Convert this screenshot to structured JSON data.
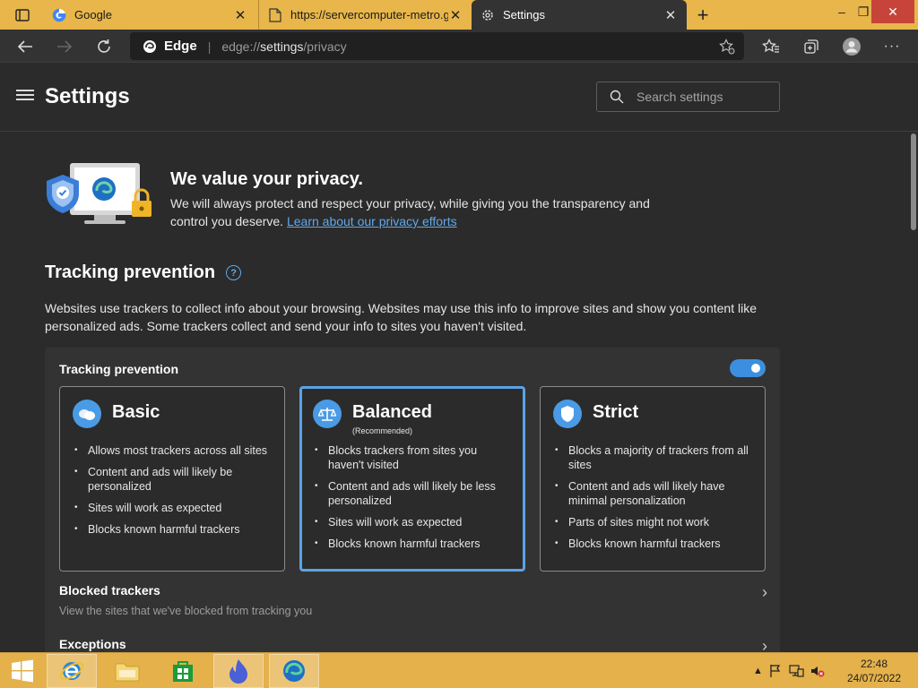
{
  "browser": {
    "tabs": [
      {
        "title": "Google",
        "icon": "google-icon",
        "active": false
      },
      {
        "title": "https://servercomputer-metro.gl",
        "icon": "page-icon",
        "active": false
      },
      {
        "title": "Settings",
        "icon": "gear-icon",
        "active": true
      }
    ],
    "address": {
      "brand": "Edge",
      "url_prefix": "edge://",
      "url_main": "settings",
      "url_suffix": "/privacy"
    }
  },
  "settings": {
    "title": "Settings",
    "search_placeholder": "Search settings",
    "hero": {
      "title": "We value your privacy.",
      "text": "We will always protect and respect your privacy, while giving you the transparency and control you deserve.",
      "link": "Learn about our privacy efforts"
    },
    "tracking": {
      "section_title": "Tracking prevention",
      "description": "Websites use trackers to collect info about your browsing. Websites may use this info to improve sites and show you content like personalized ads. Some trackers collect and send your info to sites you haven't visited.",
      "card_title": "Tracking prevention",
      "enabled": true,
      "options": [
        {
          "title": "Basic",
          "subtitle": "",
          "selected": false,
          "items": [
            "Allows most trackers across all sites",
            "Content and ads will likely be personalized",
            "Sites will work as expected",
            "Blocks known harmful trackers"
          ]
        },
        {
          "title": "Balanced",
          "subtitle": "(Recommended)",
          "selected": true,
          "items": [
            "Blocks trackers from sites you haven't visited",
            "Content and ads will likely be less personalized",
            "Sites will work as expected",
            "Blocks known harmful trackers"
          ]
        },
        {
          "title": "Strict",
          "subtitle": "",
          "selected": false,
          "items": [
            "Blocks a majority of trackers from all sites",
            "Content and ads will likely have minimal personalization",
            "Parts of sites might not work",
            "Blocks known harmful trackers"
          ]
        }
      ],
      "blocked_trackers": {
        "title": "Blocked trackers",
        "desc": "View the sites that we've blocked from tracking you"
      },
      "exceptions": {
        "title": "Exceptions"
      }
    }
  },
  "taskbar": {
    "time": "22:48",
    "date": "24/07/2022"
  },
  "colors": {
    "accent": "#4a9be5",
    "link": "#62a8ea",
    "titlebar": "#e8b64a"
  }
}
